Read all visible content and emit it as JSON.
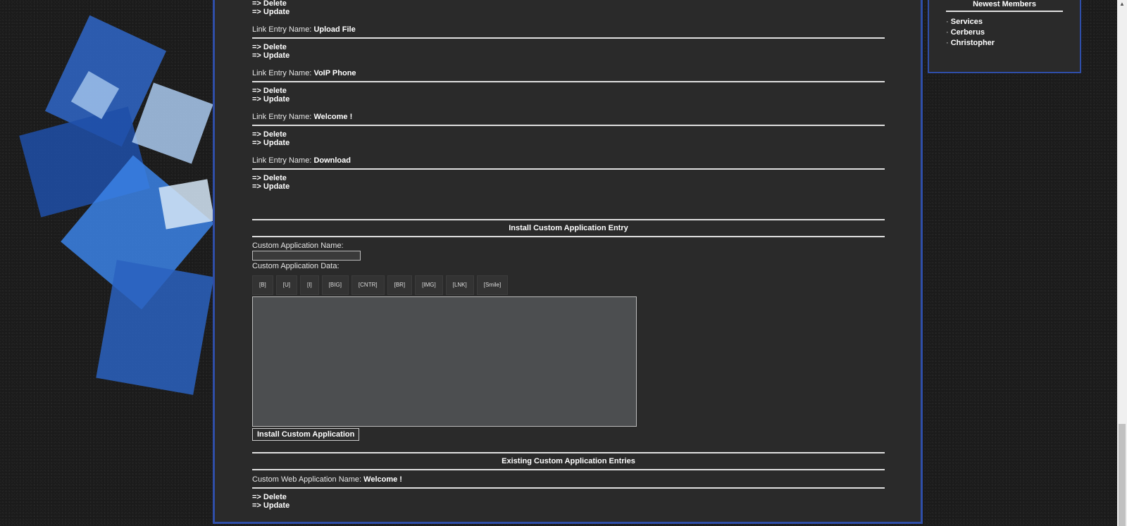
{
  "link_entries_partial": {
    "delete": "=> Delete",
    "update": "=> Update"
  },
  "link_entries": [
    {
      "label": "Link Entry Name:",
      "name": "Upload File",
      "delete": "=> Delete",
      "update": "=> Update"
    },
    {
      "label": "Link Entry Name:",
      "name": "VoIP Phone",
      "delete": "=> Delete",
      "update": "=> Update"
    },
    {
      "label": "Link Entry Name:",
      "name": "Welcome !",
      "delete": "=> Delete",
      "update": "=> Update"
    },
    {
      "label": "Link Entry Name:",
      "name": "Download",
      "delete": "=> Delete",
      "update": "=> Update"
    }
  ],
  "install_section": {
    "title": "Install Custom Application Entry",
    "name_label": "Custom Application Name:",
    "name_value": "",
    "data_label": "Custom Application Data:",
    "toolbar": [
      "[B]",
      "[U]",
      "[I]",
      "[BIG]",
      "[CNTR]",
      "[BR]",
      "[IMG]",
      "[LNK]",
      "[Smile]"
    ],
    "data_value": "",
    "submit_label": "Install Custom Application"
  },
  "existing_section": {
    "title": "Existing Custom Application Entries",
    "entry_label": "Custom Web Application Name:",
    "entry_name": "Welcome !",
    "delete": "=> Delete",
    "update": "=> Update"
  },
  "sidebar": {
    "title": "Newest Members",
    "members": [
      "Services",
      "Cerberus",
      "Christopher"
    ]
  },
  "colors": {
    "panel_border": "#2f4ea8",
    "panel_bg": "#2a2a2a",
    "page_bg": "#1b1b1b"
  }
}
